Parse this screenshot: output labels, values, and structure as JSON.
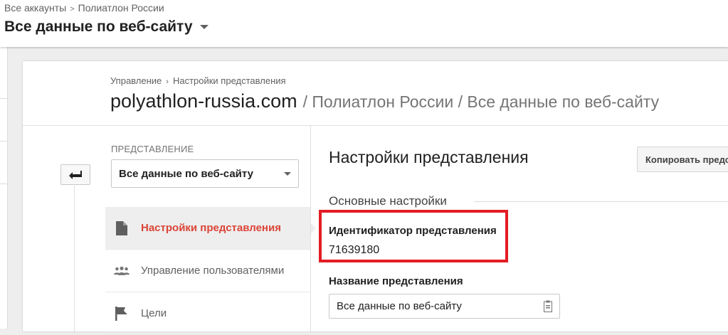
{
  "header": {
    "breadcrumb": {
      "root": "Все аккаунты",
      "separator": ">",
      "current": "Полиатлон России"
    },
    "view_title": "Все данные по веб-сайту"
  },
  "admin": {
    "breadcrumb": {
      "first": "Управление",
      "separator": "›",
      "second": "Настройки представления"
    },
    "title": {
      "domain": "polyathlon-russia.com",
      "rest": "/ Полиатлон России / Все данные по веб-сайту"
    }
  },
  "sidebar": {
    "view_label": "ПРЕДСТАВЛЕНИЕ",
    "view_selected": "Все данные по веб-сайту",
    "items": [
      {
        "label": "Настройки представления",
        "icon": "document-icon",
        "active": true
      },
      {
        "label": "Управление пользователями",
        "icon": "users-icon",
        "active": false
      },
      {
        "label": "Цели",
        "icon": "flag-icon",
        "active": false
      }
    ]
  },
  "settings": {
    "title": "Настройки представления",
    "copy_button": "Копировать представление",
    "section": "Основные настройки",
    "view_id_label": "Идентификатор представления",
    "view_id_value": "71639180",
    "view_name_label": "Название представления",
    "view_name_value": "Все данные по веб-сайту"
  },
  "colors": {
    "active": "#db4437",
    "highlight": "#e31c23"
  }
}
